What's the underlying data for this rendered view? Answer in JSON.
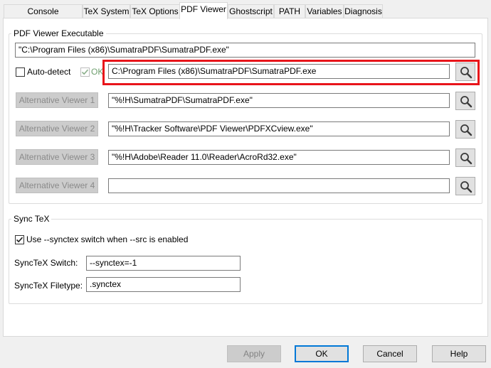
{
  "tabs": [
    {
      "label": "Console Applications"
    },
    {
      "label": "TeX System"
    },
    {
      "label": "TeX Options"
    },
    {
      "label": "PDF Viewer"
    },
    {
      "label": "Ghostscript"
    },
    {
      "label": "PATH"
    },
    {
      "label": "Variables"
    },
    {
      "label": "Diagnosis"
    }
  ],
  "active_tab": "PDF Viewer",
  "pdf_viewer": {
    "group_title": "PDF Viewer Executable",
    "executable_value": "\"C:\\Program Files (x86)\\SumatraPDF\\SumatraPDF.exe\"",
    "auto_detect_label": "Auto-detect",
    "auto_detect_checked": false,
    "ok_label": "OK",
    "ok_checked": true,
    "detected_path": "C:\\Program Files (x86)\\SumatraPDF\\SumatraPDF.exe",
    "alternatives": [
      {
        "label": "Alternative Viewer 1",
        "value": "\"%!H\\SumatraPDF\\SumatraPDF.exe\""
      },
      {
        "label": "Alternative Viewer 2",
        "value": "\"%!H\\Tracker Software\\PDF Viewer\\PDFXCview.exe\""
      },
      {
        "label": "Alternative Viewer 3",
        "value": "\"%!H\\Adobe\\Reader 11.0\\Reader\\AcroRd32.exe\""
      },
      {
        "label": "Alternative Viewer 4",
        "value": ""
      }
    ]
  },
  "synctex": {
    "group_title": "Sync TeX",
    "use_switch_label": "Use --synctex switch when --src is enabled",
    "use_switch_checked": true,
    "switch_label": "SyncTeX Switch:",
    "switch_value": "--synctex=-1",
    "filetype_label": "SyncTeX Filetype:",
    "filetype_value": ".synctex"
  },
  "buttons": {
    "apply": "Apply",
    "ok": "OK",
    "cancel": "Cancel",
    "help": "Help"
  },
  "icons": {
    "search": "magnifier-icon",
    "check": "checkmark-icon"
  },
  "colors": {
    "highlight": "#e8141a",
    "default_button_border": "#0078d7",
    "ok_check_color": "#8cb08c"
  }
}
